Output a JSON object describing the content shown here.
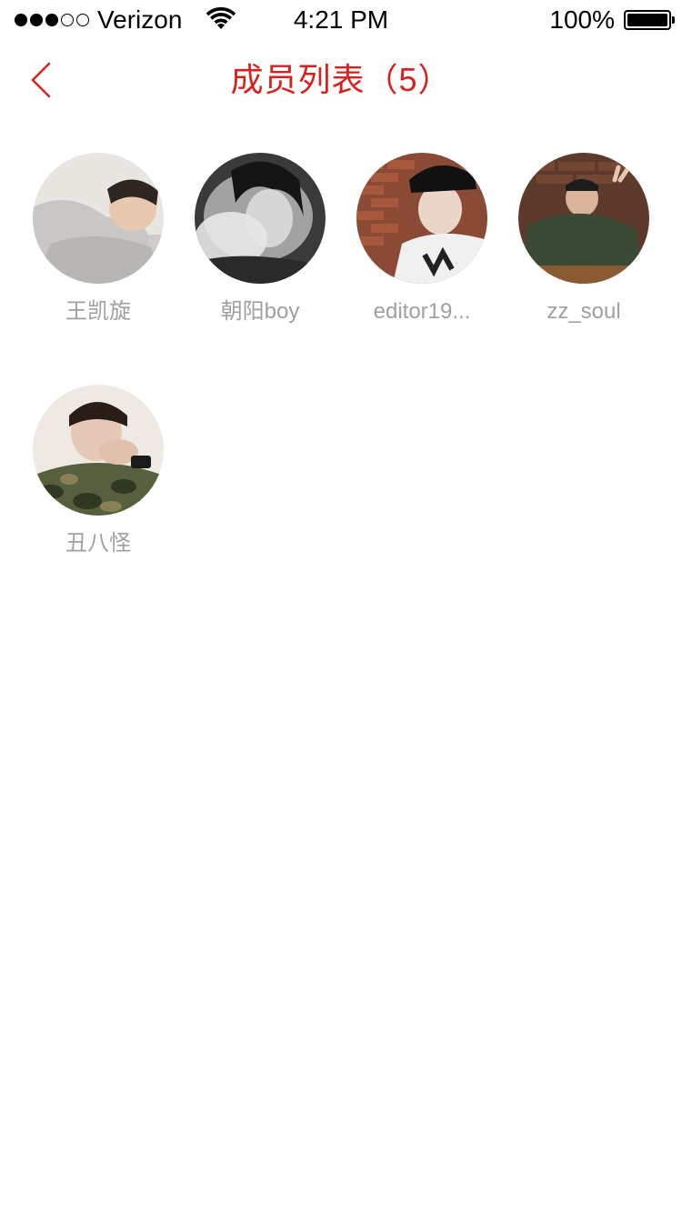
{
  "status_bar": {
    "carrier": "Verizon",
    "time": "4:21 PM",
    "battery": "100%",
    "signal_bars_filled": 3,
    "signal_bars_total": 5,
    "wifi_icon": "wifi-icon",
    "battery_level": 1.0
  },
  "nav": {
    "back_icon": "chevron-left-icon",
    "title": "成员列表（5）"
  },
  "colors": {
    "accent": "#d8211d",
    "member_name": "#a0a0a0"
  },
  "members": [
    {
      "name": "王凯旋"
    },
    {
      "name": "朝阳boy"
    },
    {
      "name": "editor19..."
    },
    {
      "name": "zz_soul"
    },
    {
      "name": "丑八怪"
    }
  ]
}
